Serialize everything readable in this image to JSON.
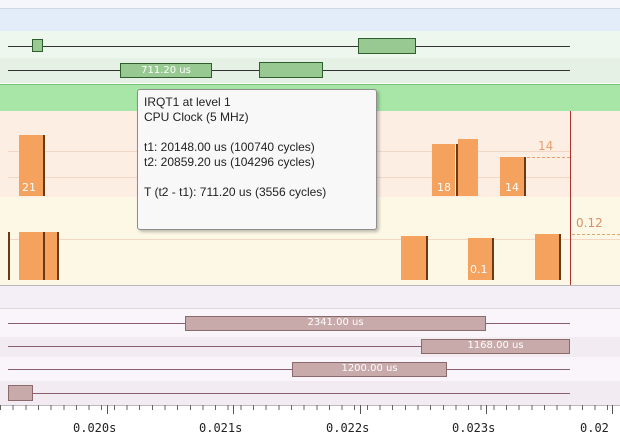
{
  "timeline": {
    "green_track_2_duration": "711.20 us"
  },
  "counts": {
    "row1_bar1": "21",
    "row1_bar2": "18",
    "row1_bar3": "14",
    "row1_threshold": "14",
    "row2_bar": "0.1",
    "row2_threshold": "0.12"
  },
  "spans": {
    "span1": "2341.00 us",
    "span2": "1168.00 us",
    "span3": "1200.00 us"
  },
  "tooltip": {
    "line1": "IRQT1 at level 1",
    "line2": "CPU Clock (5 MHz)",
    "t1": "t1:  20148.00 us (100740 cycles)",
    "t2": "t2:  20859.20 us (104296 cycles)",
    "delta": "T (t2 - t1):  711.20 us (3556 cycles)"
  },
  "axis": {
    "ticks": [
      "0.020s",
      "0.021s",
      "0.022s",
      "0.023s",
      "0.02"
    ]
  },
  "colors": {
    "green_fill": "#98c992",
    "orange_bar": "#f4a25e",
    "span_fill": "#c8aaaa",
    "cursor_line": "#b03030"
  }
}
